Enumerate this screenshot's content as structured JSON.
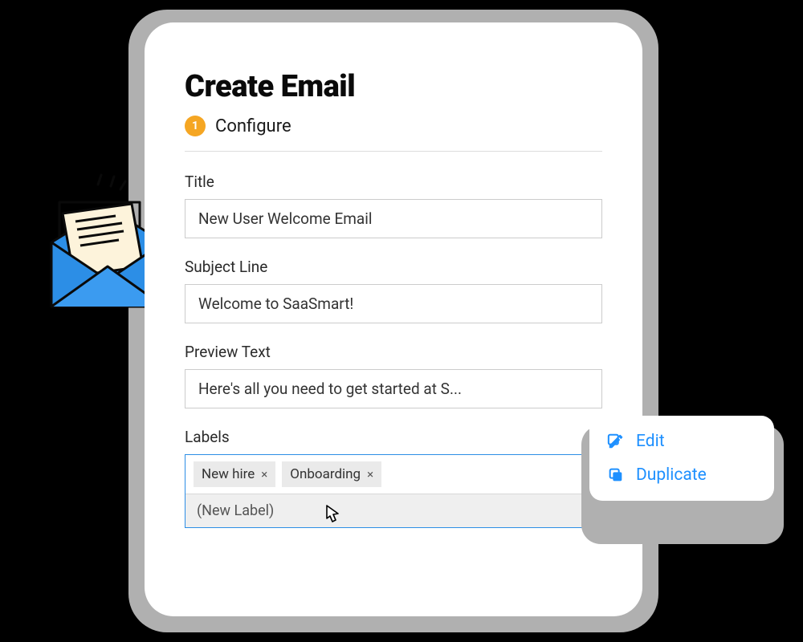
{
  "header": {
    "title": "Create Email",
    "step_number": "1",
    "step_label": "Configure"
  },
  "fields": {
    "title": {
      "label": "Title",
      "value": "New User Welcome Email"
    },
    "subject": {
      "label": "Subject Line",
      "value": "Welcome to SaaSmart!"
    },
    "preview": {
      "label": "Preview Text",
      "value": "Here's all you need to get started at S..."
    },
    "labels": {
      "label": "Labels",
      "tags": [
        {
          "text": "New hire"
        },
        {
          "text": "Onboarding"
        }
      ],
      "new_label_placeholder": "(New Label)"
    }
  },
  "context_menu": {
    "edit": "Edit",
    "duplicate": "Duplicate"
  }
}
